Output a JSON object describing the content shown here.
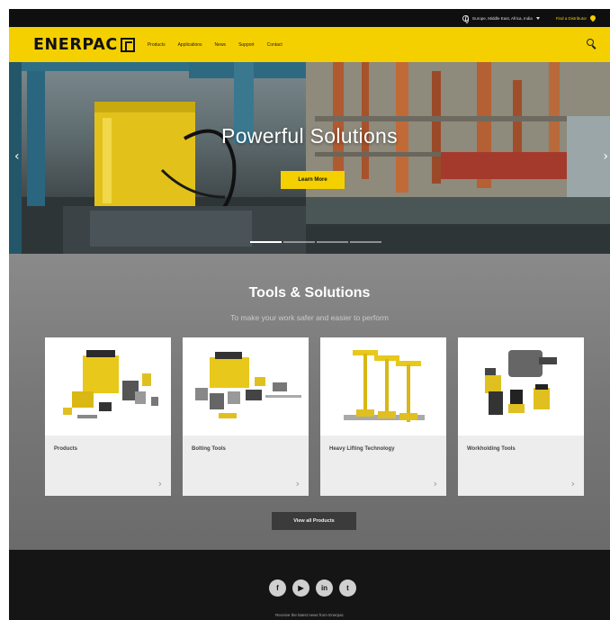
{
  "utility_bar": {
    "region": "Europe, Middle East, Africa, India",
    "find_distributor": "Find a Distributor"
  },
  "navbar": {
    "logo_text": "ENERPAC",
    "links": [
      "Products",
      "Applications",
      "News",
      "Support",
      "Contact"
    ]
  },
  "hero": {
    "title": "Powerful Solutions",
    "cta": "Learn More",
    "prev_glyph": "‹",
    "next_glyph": "›"
  },
  "tools": {
    "title": "Tools & Solutions",
    "subtitle": "To make your work safer and easier to perform",
    "cards": [
      {
        "label": "Products"
      },
      {
        "label": "Bolting Tools"
      },
      {
        "label": "Heavy Lifting Technology"
      },
      {
        "label": "Workholding Tools"
      }
    ],
    "chevron": "›",
    "view_all": "View all Products"
  },
  "footer": {
    "social": [
      {
        "icon": "facebook-icon",
        "glyph": "f"
      },
      {
        "icon": "youtube-icon",
        "glyph": "▶"
      },
      {
        "icon": "linkedin-icon",
        "glyph": "in"
      },
      {
        "icon": "twitter-icon",
        "glyph": "t"
      }
    ],
    "note": "Receive the latest news from Enerpac"
  },
  "colors": {
    "brand_yellow": "#f5d000",
    "topbar": "#0f0f0f",
    "section_gray": "#7b7b7b",
    "button_dark": "#3b3b3b"
  }
}
